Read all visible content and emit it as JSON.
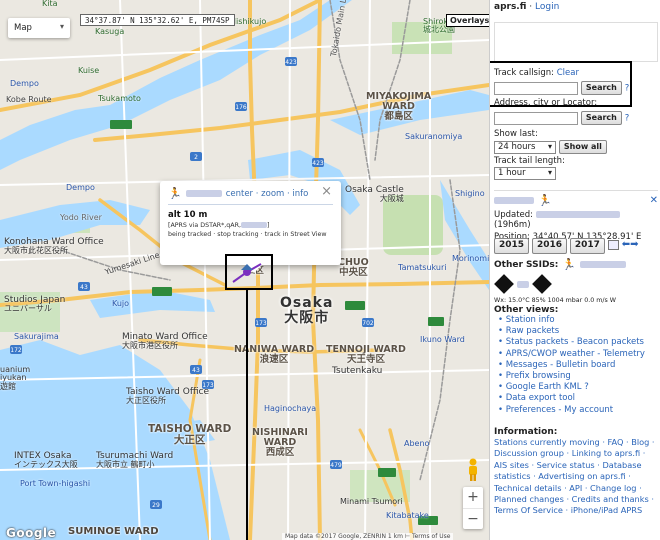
{
  "map": {
    "type_label": "Map",
    "coord_readout": "34°37.87' N 135°32.62' E, PM74SP",
    "overlays_label": "Overlays",
    "google_logo": "Google",
    "footer_text": "Map data ©2017 Google, ZENRIN  1 km ⊢  Terms of Use",
    "labels": {
      "kita": "Kita",
      "nishikujo": "Nishikujo",
      "kasuga": "Kasuga",
      "kuise": "Kuise",
      "tsukamoto": "Tsukamoto",
      "kobe_route": "Kobe Route",
      "miyakojima1": "MIYAKOJIMA",
      "miyakojima2": "WARD",
      "miyakojima3": "都島区",
      "osaka_castle": "Osaka Castle",
      "osaka_castle_jp": "大阪城",
      "chuo1": "CHUO",
      "chuo2": "中央区",
      "nishi1": "NISHI WARD",
      "nishi2": "西区",
      "osaka1": "Osaka",
      "osaka2": "大阪市",
      "konohana": "Konohana Ward Office",
      "konohana_jp": "大阪市此花区役所",
      "yumesaki": "Yumesaki Line",
      "studios": "Studios Japan",
      "studios_jp": "ユニバーサル",
      "minato": "Minato Ward Office",
      "minato_jp": "大阪市港区役所",
      "naniwa1": "NANIWA WARD",
      "naniwa2": "浪速区",
      "tennoji1": "TENNOJI WARD",
      "tennoji2": "天王寺区",
      "tsutenkaku": "Tsutenkaku",
      "taisho_office": "Taisho Ward Office",
      "taisho_office_jp": "大正区役所",
      "taisho1": "TAISHO WARD",
      "taisho2": "大正区",
      "nishinari1": "NISHINARI",
      "nishinari2": "WARD",
      "nishinari3": "西成区",
      "intex": "INTEX Osaka",
      "intex_jp": "インテックス大阪",
      "tsurumachi": "Tsurumachi Ward",
      "tsurumachi_jp": "大阪市立 鶴町小",
      "port_town": "Port Town-higashi",
      "suminoe": "SUMINOE WARD",
      "shirokita": "Shirokita Park",
      "shirokita_jp": "城北公園",
      "sakuranomiya": "Sakuranomiya",
      "ikuno": "Ikuno Ward",
      "tamatsukuri": "Tamatsukuri",
      "abeno": "Abeno",
      "minami_tsumori": "Minami Tsumori",
      "kitabatake": "Kitabatake",
      "tokaido": "Tokaido Main Line",
      "hanshin": "Hanshin Exwy",
      "yodo": "Yodo River",
      "dempo": "Dempo",
      "sakurajima": "Sakurajima",
      "kujo": "Kujo",
      "morinomiya": "Morinomiya",
      "juso": "Juso",
      "shigino": "Shigino",
      "imazato": "Imazato Line",
      "loop": "Osaka Loop Line",
      "nagai": "Nagai",
      "tsuruhashi": "Tsuruhashi",
      "kodo": "Kodo",
      "haginochaya": "Haginochaya",
      "nipponbashi": "Nipponbashi",
      "juanium": "uanium",
      "kaiyukan": "iyukan",
      "kaiyukan_jp": "遊館"
    },
    "popup": {
      "links": "center · zoom · info",
      "close": "×",
      "alt": "alt 10 m",
      "via": "[APRS via DSTAR*,qAR,",
      "via_end": "]",
      "tracking": "being tracked · stop tracking · track in Street View"
    },
    "zoom_in": "+",
    "zoom_out": "−"
  },
  "sidebar": {
    "brand": "aprs.fi",
    "brand_sep": " · ",
    "login": "Login",
    "track_callsign_label": "Track callsign:",
    "clear": "Clear",
    "search_btn": "Search",
    "help": "?",
    "address_label": "Address, city or Locator:",
    "show_last_label": "Show last:",
    "show_last_value": "24 hours",
    "show_all_btn": "Show all",
    "tail_label": "Track tail length:",
    "tail_value": "1 hour",
    "close_x": "✕",
    "updated_label": "Updated:",
    "updated_ago": "(19h6m)",
    "position": "Position: 34°40.57' N 135°28.91' E",
    "years": [
      "2015",
      "2016",
      "2017"
    ],
    "other_ssids": "Other SSIDs:",
    "wx": "Wx: 15.0°C 85% 1004 mbar 0.0 m/s W",
    "other_views": "Other views:",
    "views": [
      "Station info",
      "Raw packets",
      "Status packets - Beacon packets",
      "APRS/CWOP weather - Telemetry",
      "Messages - Bulletin board",
      "Prefix browsing",
      "Google Earth KML ?",
      "Data export tool",
      "Preferences - My account"
    ],
    "information": "Information:",
    "info_text": "Stations currently moving · FAQ · Blog · Discussion group · Linking to aprs.fi · AIS sites · Service status · Database statistics · Advertising on aprs.fi · Technical details · API · Change log · Planned changes · Credits and thanks · Terms Of Service · iPhone/iPad APRS",
    "colors": {
      "link": "#2a64b8",
      "station": "#7b2fbf"
    }
  }
}
